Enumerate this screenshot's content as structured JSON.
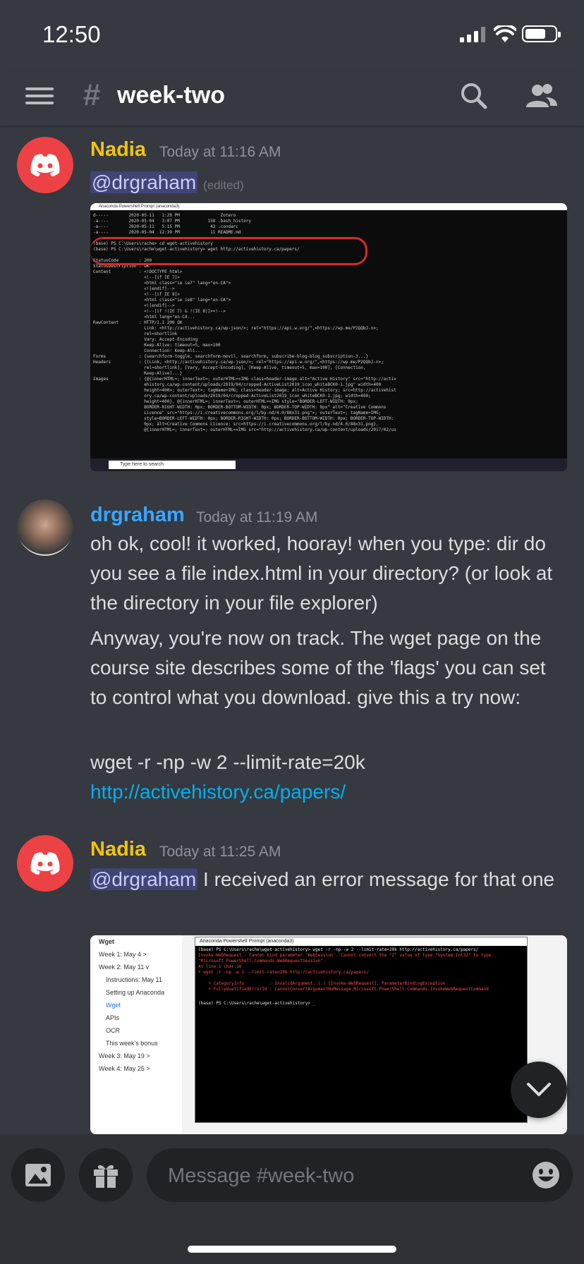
{
  "status_bar": {
    "time": "12:50"
  },
  "header": {
    "channel_name": "week-two"
  },
  "messages": [
    {
      "author": "Nadia",
      "timestamp": "Today at 11:16 AM",
      "mention": "@drgraham",
      "edited": "(edited)"
    },
    {
      "author": "drgraham",
      "timestamp": "Today at 11:19 AM",
      "p1": "oh ok, cool! it worked, hooray! when you type: dir do you see a file index.html in your directory? (or look at the directory in your file explorer)",
      "p2": "Anyway, you're now on track. The wget page on the course site describes some of the 'flags' you can set to control what you download. give this a try now:",
      "p3_text": "wget -r -np -w 2 --limit-rate=20k ",
      "p3_link": "http://activehistory.ca/papers/"
    },
    {
      "author": "Nadia",
      "timestamp": "Today at 11:25 AM",
      "mention": "@drgraham",
      "text": " I received an error message for that one"
    }
  ],
  "screenshot1": {
    "window_title": "Anaconda Powershell Prompt (anaconda3)",
    "taskbar_search": "Type here to search",
    "lines": [
      "d-----        2020-05-11   1:29 PM                Zotero",
      "-a----        2020-05-04   3:07 PM           158 .bash_history",
      "-a----        2020-05-11   5:15 PM            43 .condarc",
      "-a----        2020-05-04  12:39 PM            11 README.md",
      "",
      "(base) PS C:\\Users\\rache> cd wget-activehistory",
      "(base) PS C:\\Users\\rache\\wget-activehistory> wget http://activehistory.ca/papers/",
      "",
      "StatusCode        : 200",
      "StatusDescription : OK",
      "Content           : <!DOCTYPE html>",
      "                    <!--[if IE 7]>",
      "                    <html class=\"ie ie7\" lang=\"en-CA\">",
      "                    <![endif]-->",
      "                    <!--[if IE 8]>",
      "                    <html class=\"ie ie8\" lang=\"en-CA\">",
      "                    <![endif]-->",
      "                    <!--[if !(IE 7) & !(IE 8)]><!-->",
      "                    <html lang=\"en-CA...",
      "RawContent        : HTTP/1.1 200 OK",
      "                    Link: <http://activehistory.ca/wp-json/>; rel=\"https://api.w.org/\",<https://wp.me/P2QQbJ-n>;",
      "                    rel=shortlink",
      "                    Vary: Accept-Encoding",
      "                    Keep-Alive: timeout=5, max=100",
      "                    Connection: Keep-Ali...",
      "Forms             : {searchform-toggle, searchform-movil, searchform, subscribe-blog-blog_subscription-3...}",
      "Headers           : {[Link, <http://activehistory.ca/wp-json/>; rel=\"https://api.w.org/\",<https://wp.me/P2QQbJ-n>;",
      "                    rel=shortlink], [Vary, Accept-Encoding], [Keep-Alive, timeout=5, max=100], [Connection,",
      "                    Keep-Alive]...}",
      "Images            : {@{innerHTML=; innerText=; outerHTML=<IMG class=header-image alt=\"Active History\" src=\"http://activ",
      "                    ehistory.ca/wp-content/uploads/2019/04/cropped-ActiveList2019_icon_whiteBCK0-1.jpg\" width=400",
      "                    height=400>; outerText=; tagName=IMG; class=header-image; alt=Active History; src=http://activehist",
      "                    ory.ca/wp-content/uploads/2019/04/cropped-ActiveList2019_icon_whiteBCK0-1.jpg; width=400;",
      "                    height=400}, @{innerHTML=; innerText=; outerHTML=<IMG style=\"BORDER-LEFT-WIDTH: 0px;",
      "                    BORDER-RIGHT-WIDTH: 0px; BORDER-BOTTOM-WIDTH: 0px; BORDER-TOP-WIDTH: 0px\" alt=\"Creative Commons",
      "                    Licence\" src=\"https://i.creativecommons.org/l/by-nd/4.0/88x31.png\">; outerText=; tagName=IMG;",
      "                    style=BORDER-LEFT-WIDTH: 0px; BORDER-RIGHT-WIDTH: 0px; BORDER-BOTTOM-WIDTH: 0px; BORDER-TOP-WIDTH:",
      "                    0px; alt=Creative Commons Licence; src=https://i.creativecommons.org/l/by-nd/4.0/88x31.png},",
      "                    @{innerHTML=; innerText=; outerHTML=<IMG src=\"http://activehistory.ca/wp-content/uploads/2017/02/us"
    ]
  },
  "screenshot2": {
    "window_title": "Anaconda Powershell Prompt (anaconda3)",
    "sidebar": [
      "Wget",
      "Week 1: May 4 >",
      "Week 2: May 11 v",
      "Instructions: May 11",
      "Setting up Anaconda",
      "Wget",
      "APIs",
      "OCR",
      "This week's bonus",
      "Week 3: May 19 >",
      "Week 4: May 25 >"
    ],
    "error_lines": [
      "(base) PS C:\\Users\\rache\\wget-activehistory> wget -r -np -w 2 --limit-rate=20k http://activehistory.ca/papers/",
      "Invoke-WebRequest : Cannot bind parameter 'WebSession'. Cannot convert the \"2\" value of type \"System.Int32\" to type",
      "\"Microsoft.PowerShell.Commands.WebRequestSession\".",
      "At line:1 char:16",
      "+ wget -r -np -w 2 --limit-rate=20k http://activehistory.ca/papers/",
      "",
      "    + CategoryInfo          : InvalidArgument: (:) [Invoke-WebRequest], ParameterBindingException",
      "    + FullyQualifiedErrorId : CannotConvertArgumentNoMessage,Microsoft.PowerShell.Commands.InvokeWebRequestCommand",
      ""
    ],
    "prompt_line": "(base) PS C:\\Users\\rache\\wget-activehistory> _"
  },
  "composer": {
    "placeholder": "Message #week-two"
  },
  "colors": {
    "background": "#36393f",
    "author_nadia": "#f1c40f",
    "author_drgraham": "#3ba5ff",
    "link": "#00aff4",
    "discord_red": "#ed4245"
  }
}
